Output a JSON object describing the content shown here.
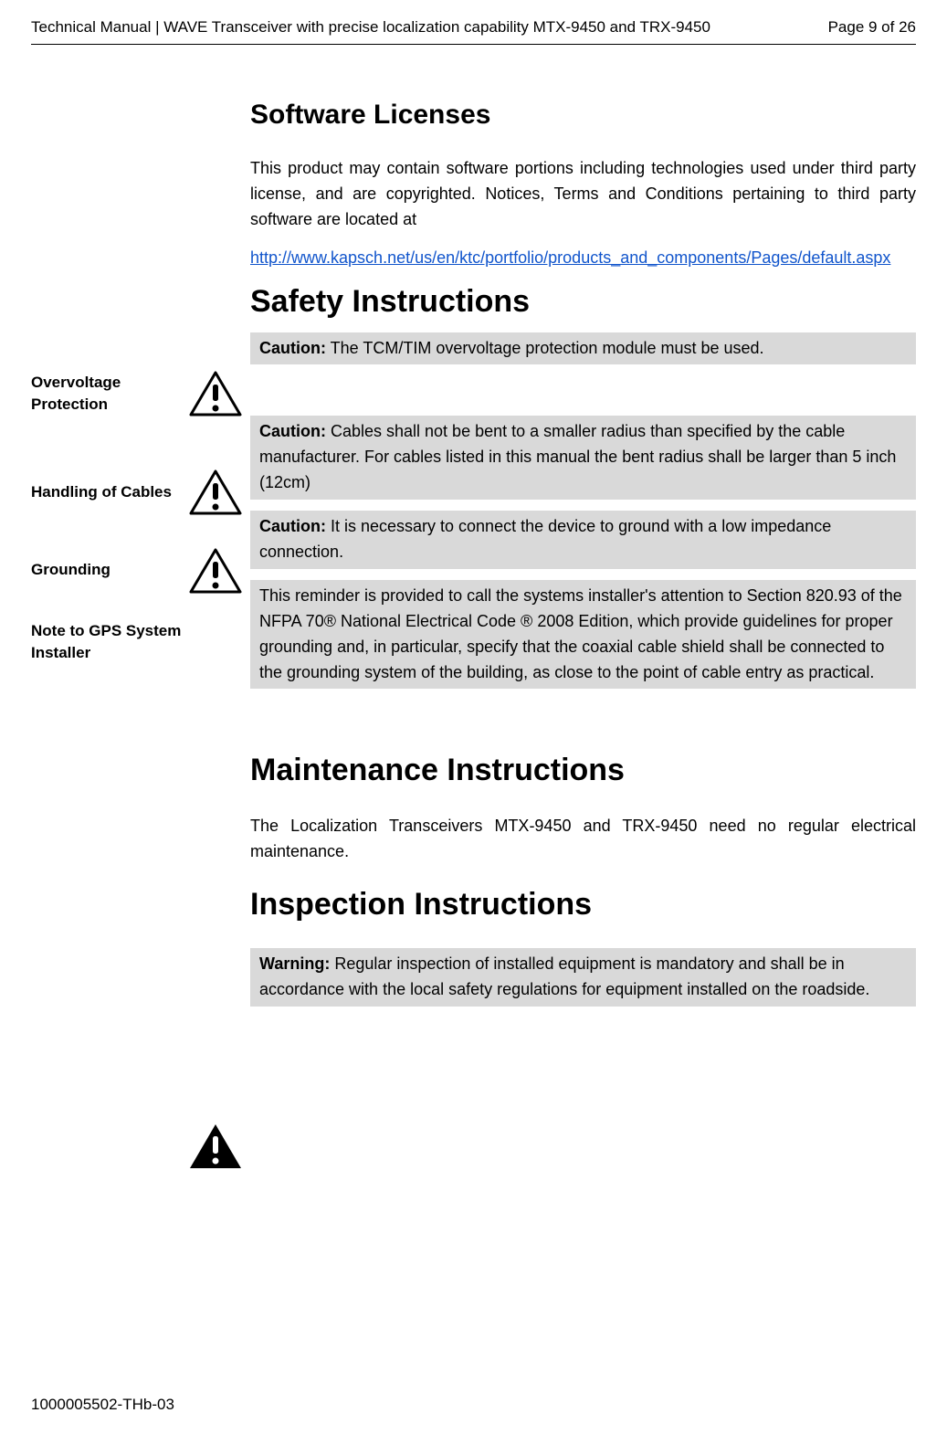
{
  "header": {
    "title": "Technical Manual | WAVE Transceiver with precise localization capability MTX-9450 and TRX-9450",
    "page": "Page 9 of 26"
  },
  "footer": "1000005502-THb-03",
  "s": {
    "licenses": {
      "h": "Software Licenses",
      "p": "This product may contain software portions including technologies used under third party license, and are copyrighted. Notices, Terms and Conditions pertaining to third party software are located at",
      "link": "http://www.kapsch.net/us/en/ktc/portfolio/products_and_components/Pages/default.aspx"
    },
    "safety": {
      "h": "Safety Instructions",
      "items": {
        "overvoltage": {
          "label": "Overvoltage Protection",
          "lead": "Caution:",
          "text": " The TCM/TIM overvoltage protection module must be used."
        },
        "cables": {
          "label": "Handling of Cables",
          "lead": "Caution:",
          "text": " Cables shall not be bent to a smaller radius than specified by the cable manufacturer. For cables listed in this manual the bent radius shall be larger than 5 inch (12cm)"
        },
        "grounding": {
          "label": "Grounding",
          "lead": "Caution:",
          "text": " It is necessary to connect the device to ground with a low impedance connection."
        },
        "gps": {
          "label": "Note to GPS System Installer",
          "text": "This reminder is provided to call the systems installer's attention to Section 820.93 of the NFPA 70® National Electrical Code ® 2008 Edition, which provide guidelines for proper grounding and, in particular, specify that the coaxial cable shield shall be connected to the grounding system of the building, as close to the point of cable entry as practical."
        }
      }
    },
    "maint": {
      "h": "Maintenance Instructions",
      "p": "The Localization Transceivers MTX-9450 and TRX-9450 need no regular electrical maintenance."
    },
    "insp": {
      "h": "Inspection Instructions",
      "warn": {
        "lead": "Warning:",
        "text": " Regular inspection of installed equipment is mandatory and shall be in accordance with the local safety regulations for equipment installed on the roadside."
      }
    }
  }
}
